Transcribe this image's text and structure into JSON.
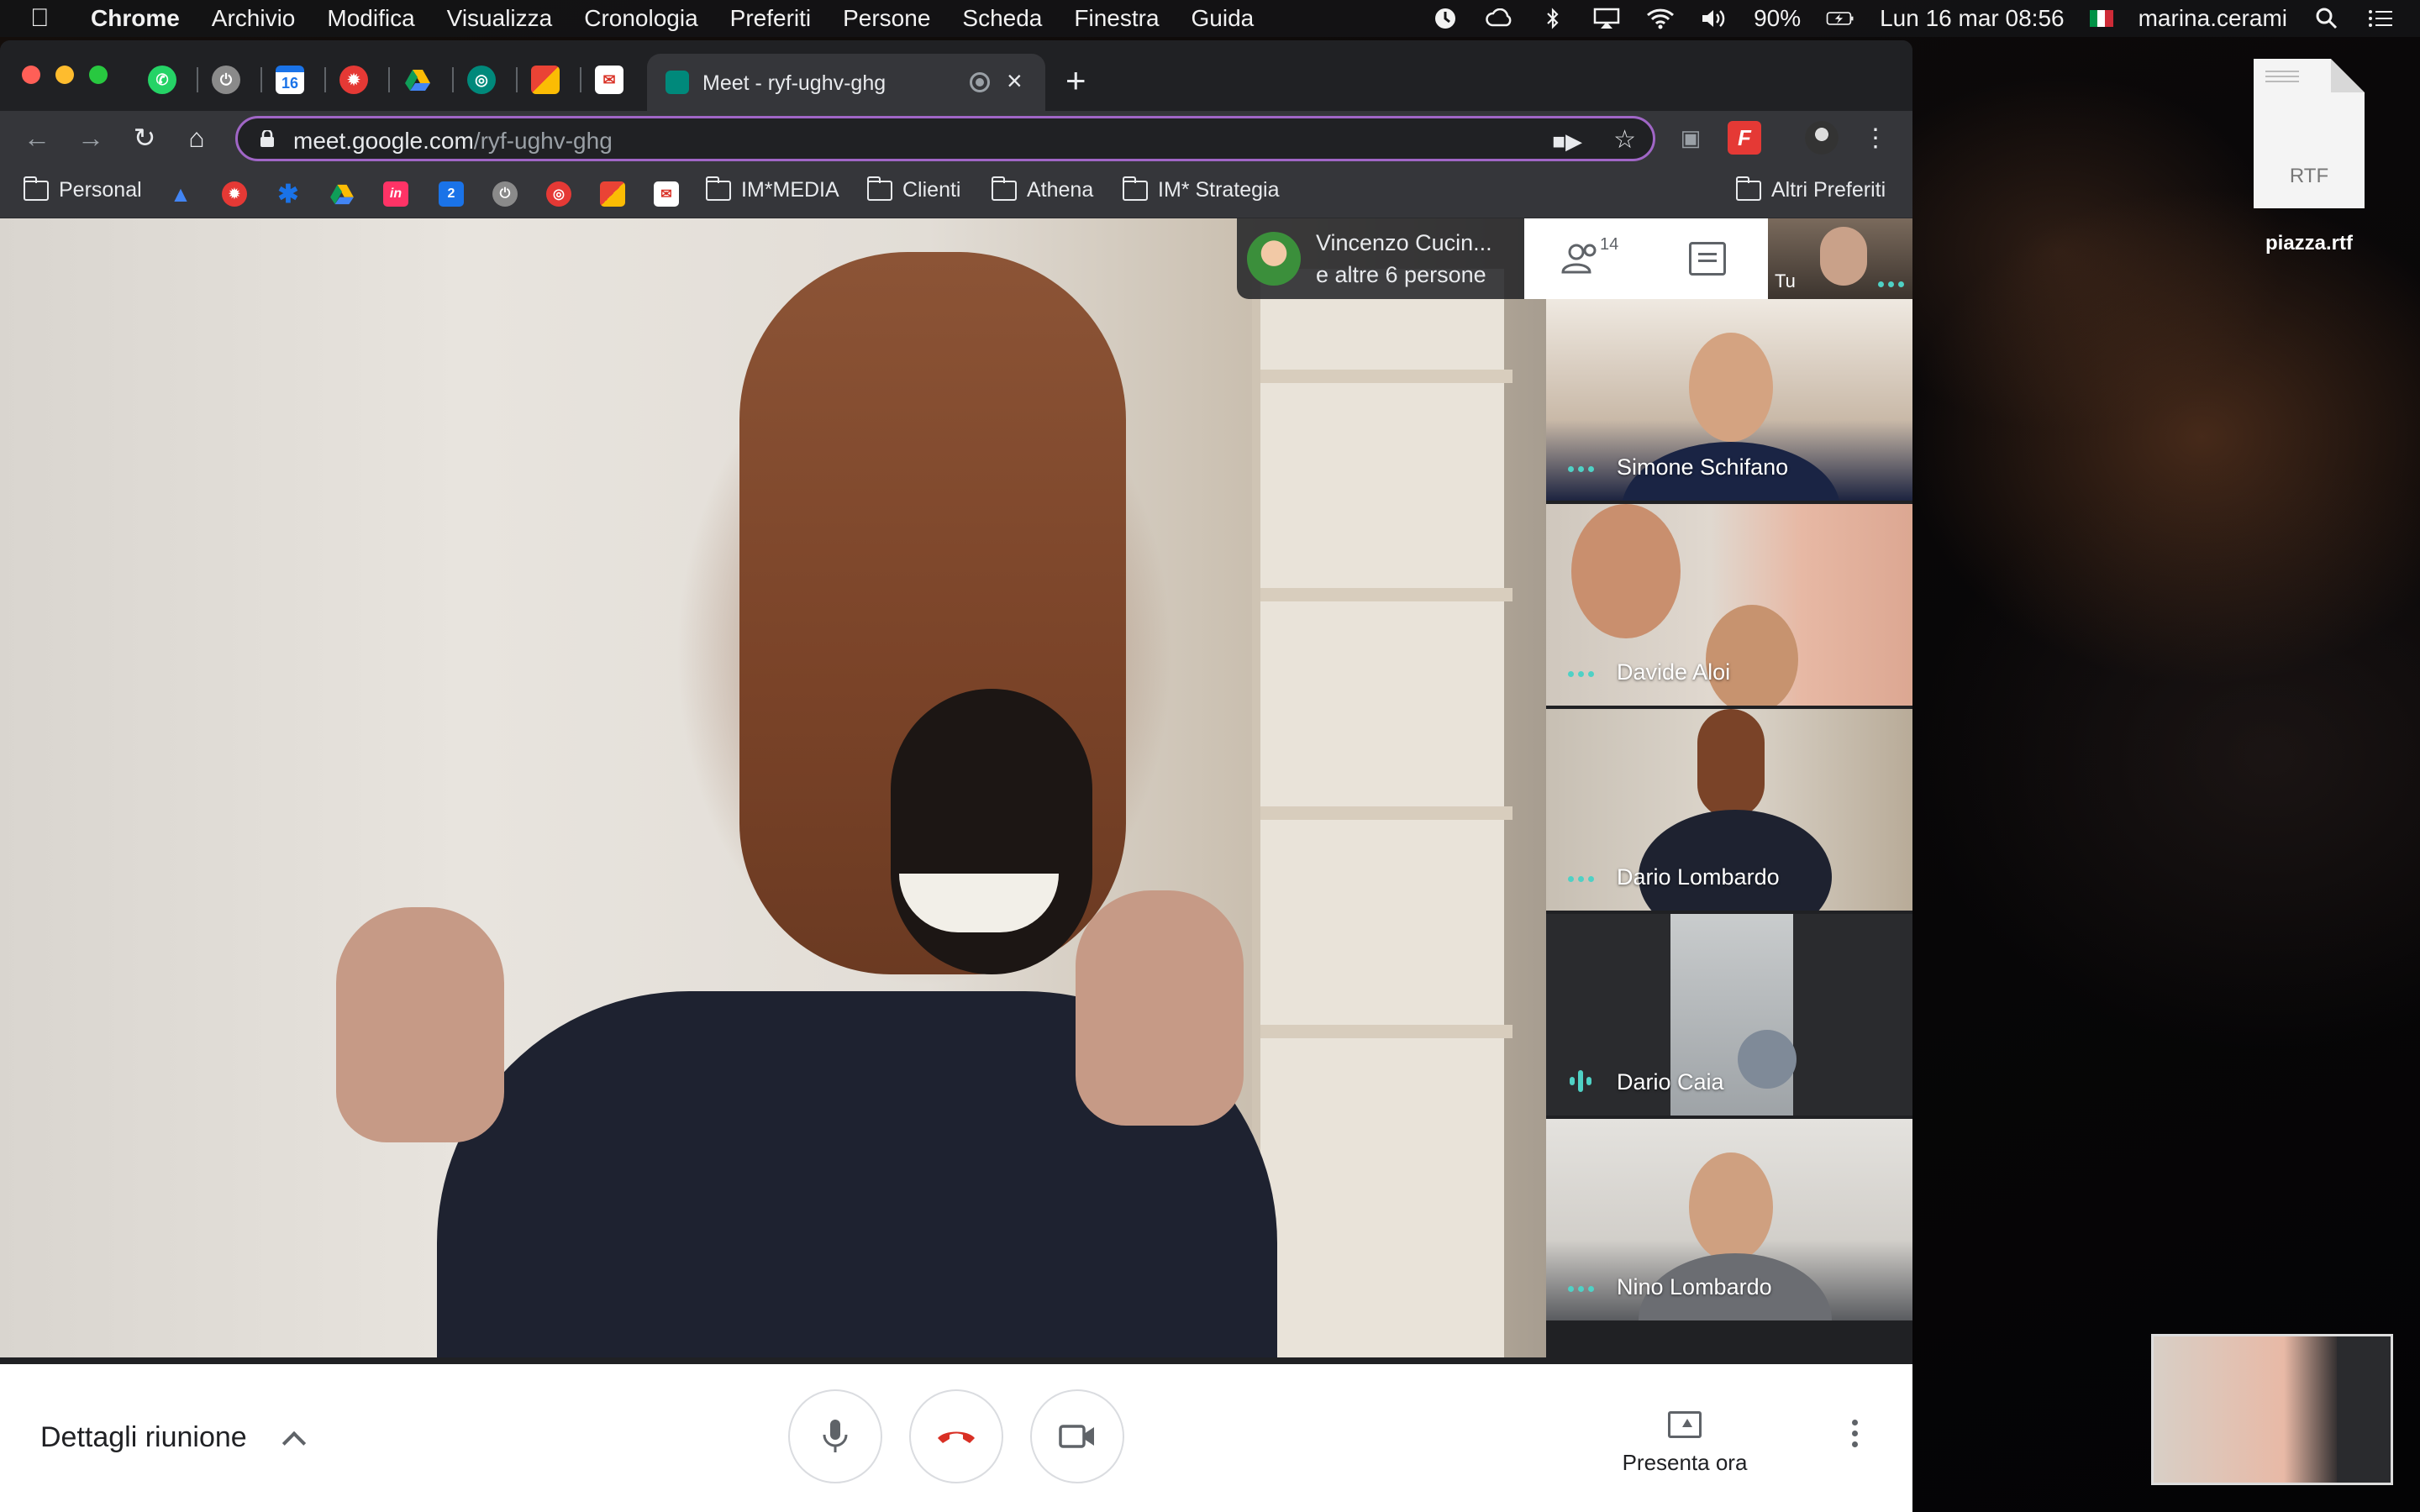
{
  "menubar": {
    "app": "Chrome",
    "items": [
      "Archivio",
      "Modifica",
      "Visualizza",
      "Cronologia",
      "Preferiti",
      "Persone",
      "Scheda",
      "Finestra",
      "Guida"
    ],
    "battery": "90%",
    "datetime": "Lun 16 mar  08:56",
    "user": "marina.cerami"
  },
  "browser": {
    "active_tab_title": "Meet - ryf-ughv-ghg",
    "url_host": "meet.google.com",
    "url_path": "/ryf-ughv-ghg",
    "calendar_badge": "16",
    "bookmarks": {
      "personal": "Personal",
      "calendar_badge": "2",
      "folders": [
        "IM*MEDIA",
        "Clienti",
        "Athena",
        "IM* Strategia"
      ],
      "other": "Altri Preferiti"
    }
  },
  "meet": {
    "presenter_line1": "Vincenzo Cucin...",
    "presenter_line2": "e altre 6 persone",
    "participant_count": "14",
    "self_label": "Tu",
    "participants": [
      {
        "name": "Simone Schifano"
      },
      {
        "name": "Davide Aloi"
      },
      {
        "name": "Dario Lombardo"
      },
      {
        "name": "Dario Caia"
      },
      {
        "name": "Nino Lombardo"
      }
    ],
    "details_label": "Dettagli riunione",
    "present_label": "Presenta ora",
    "accent_color": "#4fd1c5",
    "hangup_color": "#d93025"
  },
  "desktop": {
    "file_ext": "RTF",
    "file_name": "piazza.rtf"
  }
}
